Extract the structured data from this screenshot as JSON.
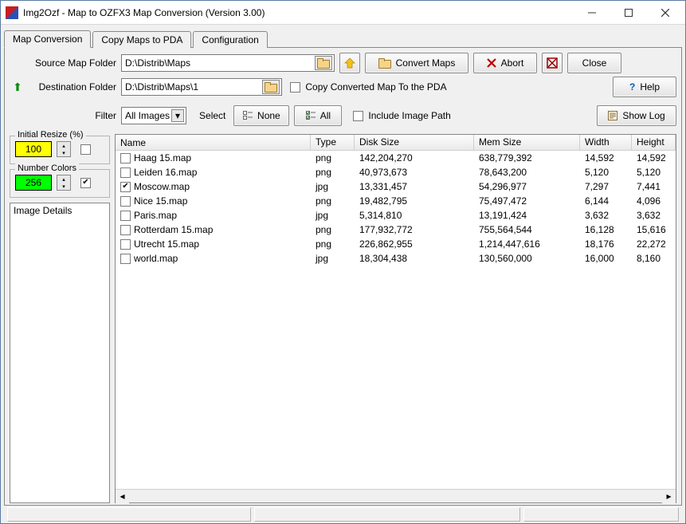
{
  "window": {
    "title": "Img2Ozf - Map to OZFX3 Map Conversion (Version 3.00)"
  },
  "tabs": [
    {
      "label": "Map Conversion"
    },
    {
      "label": "Copy Maps to PDA"
    },
    {
      "label": "Configuration"
    }
  ],
  "toolbar": {
    "source_label": "Source Map Folder",
    "source_value": "D:\\Distrib\\Maps",
    "dest_label": "Destination Folder",
    "dest_value": "D:\\Distrib\\Maps\\1",
    "filter_label": "Filter",
    "filter_value": "All Images",
    "select_label": "Select",
    "none_label": "None",
    "all_label": "All",
    "convert_label": "Convert Maps",
    "abort_label": "Abort",
    "close_label": "Close",
    "help_label": "Help",
    "showlog_label": "Show Log",
    "copy_pda_label": "Copy Converted Map To the PDA",
    "include_path_label": "Include Image Path"
  },
  "left": {
    "resize_title": "Initial Resize (%)",
    "resize_value": "100",
    "colors_title": "Number Colors",
    "colors_value": "256",
    "details_title": "Image Details"
  },
  "grid": {
    "columns": [
      "Name",
      "Type",
      "Disk Size",
      "Mem Size",
      "Width",
      "Height"
    ],
    "rows": [
      {
        "checked": false,
        "name": "Haag 15.map",
        "type": "png",
        "disk": "142,204,270",
        "mem": "638,779,392",
        "w": "14,592",
        "h": "14,592"
      },
      {
        "checked": false,
        "name": "Leiden 16.map",
        "type": "png",
        "disk": "40,973,673",
        "mem": "78,643,200",
        "w": "5,120",
        "h": "5,120"
      },
      {
        "checked": true,
        "name": "Moscow.map",
        "type": "jpg",
        "disk": "13,331,457",
        "mem": "54,296,977",
        "w": "7,297",
        "h": "7,441"
      },
      {
        "checked": false,
        "name": "Nice 15.map",
        "type": "png",
        "disk": "19,482,795",
        "mem": "75,497,472",
        "w": "6,144",
        "h": "4,096"
      },
      {
        "checked": false,
        "name": "Paris.map",
        "type": "jpg",
        "disk": "5,314,810",
        "mem": "13,191,424",
        "w": "3,632",
        "h": "3,632"
      },
      {
        "checked": false,
        "name": "Rotterdam 15.map",
        "type": "png",
        "disk": "177,932,772",
        "mem": "755,564,544",
        "w": "16,128",
        "h": "15,616"
      },
      {
        "checked": false,
        "name": "Utrecht 15.map",
        "type": "png",
        "disk": "226,862,955",
        "mem": "1,214,447,616",
        "w": "18,176",
        "h": "22,272"
      },
      {
        "checked": false,
        "name": "world.map",
        "type": "jpg",
        "disk": "18,304,438",
        "mem": "130,560,000",
        "w": "16,000",
        "h": "8,160"
      }
    ]
  },
  "colors": {
    "resize_bg": "#ffff00",
    "colors_bg": "#00ff00",
    "abort_x": "#c00000"
  }
}
